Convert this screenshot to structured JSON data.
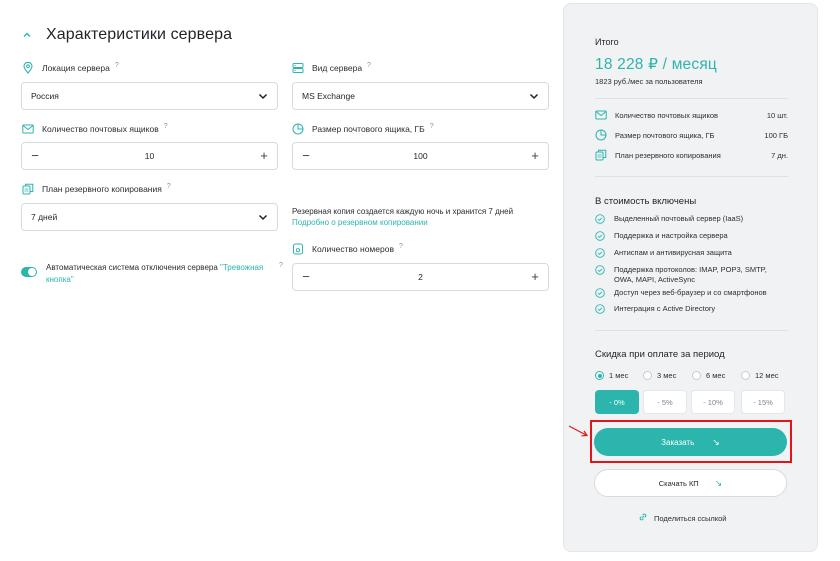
{
  "section": {
    "title": "Характеристики сервера"
  },
  "fields": {
    "location": {
      "label": "Локация сервера",
      "value": "Россия"
    },
    "server_type": {
      "label": "Вид сервера",
      "value": "MS Exchange"
    },
    "mailboxes": {
      "label": "Количество почтовых ящиков",
      "value": "10"
    },
    "mailbox_size": {
      "label": "Размер почтового ящика, ГБ",
      "value": "100"
    },
    "backup_plan": {
      "label": "План резервного копирования",
      "value": "7 дней"
    },
    "numbers": {
      "label": "Количество номеров",
      "value": "2"
    }
  },
  "backup_note": {
    "text": "Резервная копия создается каждую ночь и хранится 7 дней",
    "link": "Подробно о резервном копировании"
  },
  "alarm_toggle": {
    "text": "Автоматическая система отключения сервера ",
    "link": "\"Тревожная кнопка\"",
    "enabled": true
  },
  "stepper": {
    "minus": "−",
    "plus": "+"
  },
  "info_mark": "?",
  "summary": {
    "total_label": "Итого",
    "price": "18 228 ₽ / месяц",
    "per_user": "1823 руб./мес за пользователя",
    "specs": [
      {
        "label": "Количество почтовых ящиков",
        "value": "10 шт.",
        "icon": "mail-icon"
      },
      {
        "label": "Размер почтового ящика, ГБ",
        "value": "100 ГБ",
        "icon": "pie-icon"
      },
      {
        "label": "План резервного копирования",
        "value": "7 дн.",
        "icon": "backup-icon"
      }
    ],
    "included_title": "В стоимость включены",
    "included": [
      "Выделенный почтовый сервер (IaaS)",
      "Поддержка и настройка сервера",
      "Антиспам и антивирусная защита",
      "Поддержка протоколов: IMAP, POP3, SMTP, OWA, MAPI, ActiveSync",
      "Доступ через веб-браузер и со смартфонов",
      "Интеграция с Active Directory"
    ],
    "discount_title": "Скидка при оплате за период",
    "periods": [
      {
        "label": "1 мес",
        "discount": "- 0%",
        "selected": true
      },
      {
        "label": "3 мес",
        "discount": "- 5%",
        "selected": false
      },
      {
        "label": "6 мес",
        "discount": "- 10%",
        "selected": false
      },
      {
        "label": "12 мес",
        "discount": "- 15%",
        "selected": false
      }
    ],
    "order_label": "Заказать",
    "kp_label": "Скачать КП",
    "share_label": "Поделиться ссылкой",
    "arrow_glyph": "↘"
  },
  "colors": {
    "accent": "#2bb5ad",
    "panel_bg": "#f0f2f4",
    "highlight": "#e0161b"
  }
}
